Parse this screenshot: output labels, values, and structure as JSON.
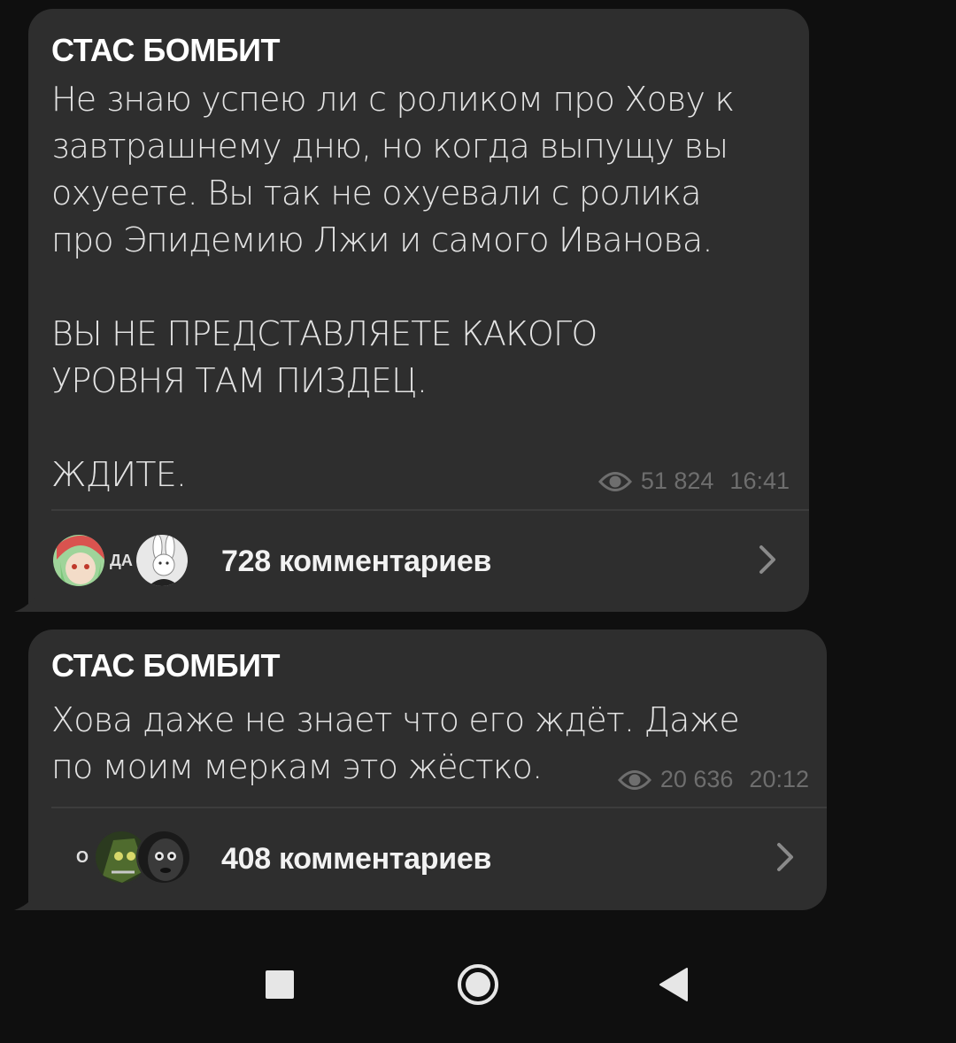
{
  "posts": [
    {
      "author": "СТАС БОМБИТ",
      "text": "Не знаю успею ли с роликом про Хову к\nзавтрашнему дню, но когда выпущу вы\nохуеете. Вы так не охуевали с ролика\nпро Эпидемию Лжи и самого Иванова.\n\nВЫ НЕ ПРЕДСТАВЛЯЕТЕ КАКОГО\nУРОВНЯ ТАМ ПИЗДЕЦ.\n\nЖДИТЕ.",
      "views": "51 824",
      "time": "16:41",
      "avatar_text": "ДА",
      "comments": "728 комментариев"
    },
    {
      "author": "СТАС БОМБИТ",
      "text": "Хова даже не знает что его ждёт. Даже\nпо моим меркам это жёстко.",
      "views": "20 636",
      "time": "20:12",
      "avatar_text": "О",
      "comments": "408 комментариев"
    }
  ],
  "colors": {
    "background": "#0f0f0f",
    "bubble": "#2e2e2e",
    "meta": "#6e6e6e",
    "text": "#e3e3e3"
  },
  "icons": [
    "eye-icon",
    "chevron-right-icon",
    "stop-icon",
    "home-icon",
    "back-icon"
  ]
}
